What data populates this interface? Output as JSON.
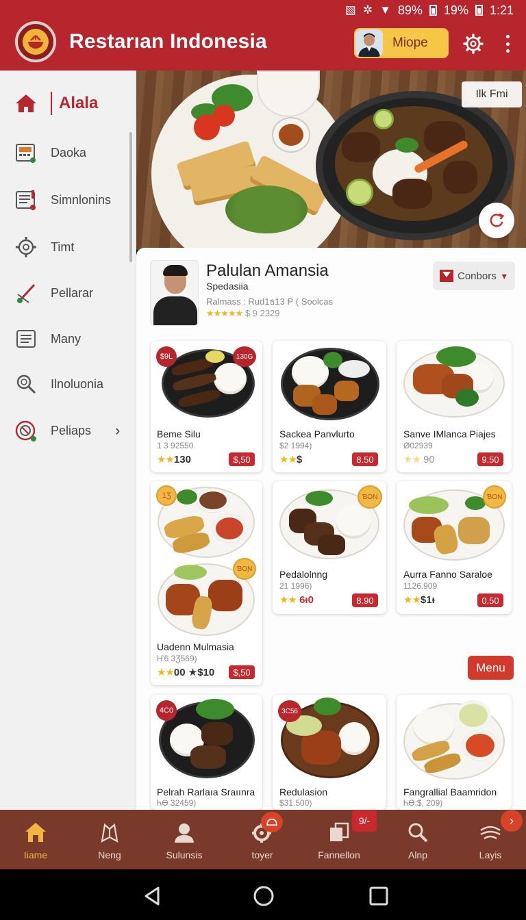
{
  "status": {
    "percent_a": "89%",
    "percent_b": "19%",
    "time": "1:21"
  },
  "app": {
    "title": "Restarıan Indonesia",
    "user_name": "Miope"
  },
  "sidebar": {
    "items": [
      {
        "label": "Alala",
        "icon": "home-icon"
      },
      {
        "label": "Daoka",
        "icon": "register-icon"
      },
      {
        "label": "Simnlonins",
        "icon": "receipt-icon"
      },
      {
        "label": "Timt",
        "icon": "gear-icon"
      },
      {
        "label": "Pellarar",
        "icon": "tools-icon"
      },
      {
        "label": "Many",
        "icon": "list-icon"
      },
      {
        "label": "Ilnoluonia",
        "icon": "search-icon"
      },
      {
        "label": "Peliaps",
        "icon": "target-icon"
      }
    ]
  },
  "hero": {
    "label": "Ilk Fmi"
  },
  "restaurant": {
    "name": "Palulan Amansia",
    "subtitle": "Spedasiia",
    "meta": "Ralmass : Rud1ธ13 Ᵽ ( Soolcas",
    "rating_stars": "★★★★★",
    "rating_text": "$ 9 2329",
    "combos_label": "Conbors"
  },
  "cards": [
    {
      "name": "Beme Silu",
      "meta": "1 3 92550",
      "rating": "★★",
      "rating_value": "130",
      "price": "$,50",
      "badge_left": "$9L",
      "badge_right": "130G"
    },
    {
      "name": "Sackea Panvlurto",
      "meta": "$2 1994)",
      "rating": "★★",
      "rating_value": "$",
      "price": "8.50"
    },
    {
      "name": "Sanve IMlanca Piajes",
      "meta": "Ø02939",
      "rating": "★★",
      "rating_value": "90",
      "price": "9.50"
    },
    {
      "name": "Uadenn Mulmasia",
      "meta": "Ҥ6 3Ʒ569)",
      "rating": "★★",
      "rating_value": "00",
      "rating_extra": "★$10",
      "price": "$,50",
      "badge_left": "1Ʒ",
      "badge_right": "ƁOƝ"
    },
    {
      "name": "Pedalolnng",
      "meta": "21 1996)",
      "rating": "★★",
      "rating_value": "6ᵻ0",
      "price": "8.90",
      "badge_right": "ƁON"
    },
    {
      "name": "Aurra Fanno Saraloe",
      "meta": "1126.909",
      "rating": "★★",
      "rating_value": "$1ᵻ",
      "price": "0.50",
      "badge_right": "ƁON"
    },
    {
      "name": "Pelrah Rarlaıa Sraıınra",
      "meta": "ᏂӨ 32459)",
      "badge_left": "4C0"
    },
    {
      "name": "Redulasion",
      "meta": "$31.500)",
      "badge_left": "3C56"
    },
    {
      "name": "Fangrallial Baamridon",
      "meta": "ᏂӨ;$, 209)"
    }
  ],
  "menu_button": "Menu",
  "bottom_nav": [
    {
      "label": "Iiame",
      "icon": "home-icon",
      "active": true
    },
    {
      "label": "Neng",
      "icon": "map-icon"
    },
    {
      "label": "Sulunsis",
      "icon": "user-icon"
    },
    {
      "label": "toyer",
      "icon": "settings-icon"
    },
    {
      "label": "Fannellon",
      "icon": "copy-icon"
    },
    {
      "label": "Alnp",
      "icon": "search-icon"
    },
    {
      "label": "Layis",
      "icon": "layers-icon"
    }
  ],
  "bottom_badge": "9/-",
  "colors": {
    "brand_red": "#b7262c",
    "accent_gold": "#f6c646",
    "nav_brown": "#7a3a2b"
  }
}
